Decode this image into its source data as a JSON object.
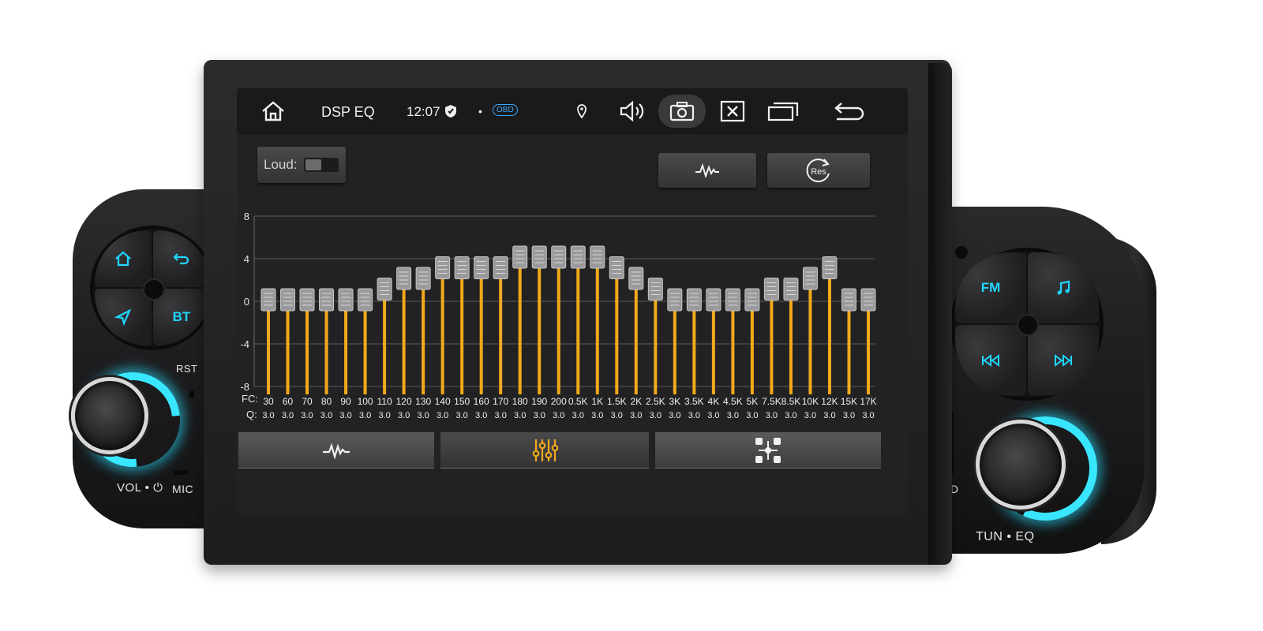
{
  "status_bar": {
    "title": "DSP EQ",
    "time": "12:07",
    "obd_badge": "OBD",
    "dot": "•",
    "icons": [
      "home-icon",
      "shield-icon",
      "location-pin-icon",
      "volume-icon",
      "screenshot-icon",
      "close-window-icon",
      "recent-apps-icon",
      "back-icon"
    ]
  },
  "toolbar": {
    "loud_label": "Loud:",
    "loud_enabled": false,
    "preset_icon": "waveform-icon",
    "reset_icon": "reset-icon",
    "reset_text": "Res"
  },
  "eq": {
    "y_ticks": [
      "8",
      "4",
      "0",
      "-4",
      "-8"
    ],
    "fc_label": "FC:",
    "q_label": "Q:",
    "bands": [
      {
        "fc": "30",
        "q": "3.0",
        "gain": 0
      },
      {
        "fc": "60",
        "q": "3.0",
        "gain": 0
      },
      {
        "fc": "70",
        "q": "3.0",
        "gain": 0
      },
      {
        "fc": "80",
        "q": "3.0",
        "gain": 0
      },
      {
        "fc": "90",
        "q": "3.0",
        "gain": 0
      },
      {
        "fc": "100",
        "q": "3.0",
        "gain": 0
      },
      {
        "fc": "110",
        "q": "3.0",
        "gain": 1
      },
      {
        "fc": "120",
        "q": "3.0",
        "gain": 2
      },
      {
        "fc": "130",
        "q": "3.0",
        "gain": 2
      },
      {
        "fc": "140",
        "q": "3.0",
        "gain": 3
      },
      {
        "fc": "150",
        "q": "3.0",
        "gain": 3
      },
      {
        "fc": "160",
        "q": "3.0",
        "gain": 3
      },
      {
        "fc": "170",
        "q": "3.0",
        "gain": 3
      },
      {
        "fc": "180",
        "q": "3.0",
        "gain": 4
      },
      {
        "fc": "190",
        "q": "3.0",
        "gain": 4
      },
      {
        "fc": "200",
        "q": "3.0",
        "gain": 4
      },
      {
        "fc": "0.5K",
        "q": "3.0",
        "gain": 4
      },
      {
        "fc": "1K",
        "q": "3.0",
        "gain": 4
      },
      {
        "fc": "1.5K",
        "q": "3.0",
        "gain": 3
      },
      {
        "fc": "2K",
        "q": "3.0",
        "gain": 2
      },
      {
        "fc": "2.5K",
        "q": "3.0",
        "gain": 1
      },
      {
        "fc": "3K",
        "q": "3.0",
        "gain": 0
      },
      {
        "fc": "3.5K",
        "q": "3.0",
        "gain": 0
      },
      {
        "fc": "4K",
        "q": "3.0",
        "gain": 0
      },
      {
        "fc": "4.5K",
        "q": "3.0",
        "gain": 0
      },
      {
        "fc": "5K",
        "q": "3.0",
        "gain": 0
      },
      {
        "fc": "7.5K",
        "q": "3.0",
        "gain": 1
      },
      {
        "fc": "8.5K",
        "q": "3.0",
        "gain": 1
      },
      {
        "fc": "10K",
        "q": "3.0",
        "gain": 2
      },
      {
        "fc": "12K",
        "q": "3.0",
        "gain": 3
      },
      {
        "fc": "15K",
        "q": "3.0",
        "gain": 0
      },
      {
        "fc": "17K",
        "q": "3.0",
        "gain": 0
      }
    ],
    "bar_color": "#f2a91b",
    "slider_color": "#9a9a9c"
  },
  "bottom_tabs": [
    {
      "icon": "waveform-icon",
      "active": false
    },
    {
      "icon": "sliders-icon",
      "active": true
    },
    {
      "icon": "speaker-position-icon",
      "active": false
    }
  ],
  "device": {
    "left_pad": [
      "home-icon",
      "back-icon",
      "navigation-icon",
      "BT"
    ],
    "right_pad": [
      "FM",
      "music-icon",
      "previous-track-icon",
      "next-track-icon"
    ],
    "labels": {
      "rst": "RST",
      "vol": "VOL",
      "mic": "MIC",
      "sd": "SD",
      "tun": "TUN",
      "eq": "EQ",
      "sep": "•"
    },
    "accent": "#1fd6ff"
  }
}
